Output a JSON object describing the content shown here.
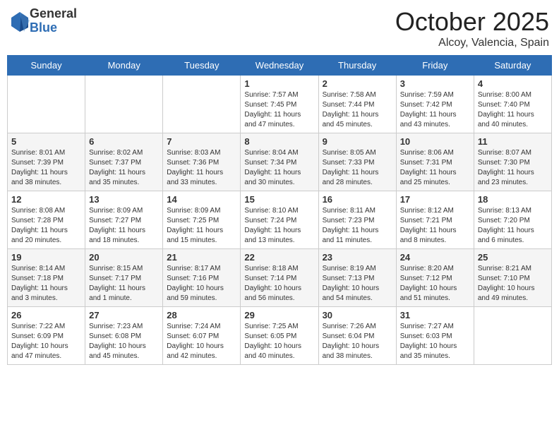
{
  "header": {
    "logo_general": "General",
    "logo_blue": "Blue",
    "month": "October 2025",
    "location": "Alcoy, Valencia, Spain"
  },
  "weekdays": [
    "Sunday",
    "Monday",
    "Tuesday",
    "Wednesday",
    "Thursday",
    "Friday",
    "Saturday"
  ],
  "weeks": [
    [
      {
        "day": "",
        "info": ""
      },
      {
        "day": "",
        "info": ""
      },
      {
        "day": "",
        "info": ""
      },
      {
        "day": "1",
        "info": "Sunrise: 7:57 AM\nSunset: 7:45 PM\nDaylight: 11 hours and 47 minutes."
      },
      {
        "day": "2",
        "info": "Sunrise: 7:58 AM\nSunset: 7:44 PM\nDaylight: 11 hours and 45 minutes."
      },
      {
        "day": "3",
        "info": "Sunrise: 7:59 AM\nSunset: 7:42 PM\nDaylight: 11 hours and 43 minutes."
      },
      {
        "day": "4",
        "info": "Sunrise: 8:00 AM\nSunset: 7:40 PM\nDaylight: 11 hours and 40 minutes."
      }
    ],
    [
      {
        "day": "5",
        "info": "Sunrise: 8:01 AM\nSunset: 7:39 PM\nDaylight: 11 hours and 38 minutes."
      },
      {
        "day": "6",
        "info": "Sunrise: 8:02 AM\nSunset: 7:37 PM\nDaylight: 11 hours and 35 minutes."
      },
      {
        "day": "7",
        "info": "Sunrise: 8:03 AM\nSunset: 7:36 PM\nDaylight: 11 hours and 33 minutes."
      },
      {
        "day": "8",
        "info": "Sunrise: 8:04 AM\nSunset: 7:34 PM\nDaylight: 11 hours and 30 minutes."
      },
      {
        "day": "9",
        "info": "Sunrise: 8:05 AM\nSunset: 7:33 PM\nDaylight: 11 hours and 28 minutes."
      },
      {
        "day": "10",
        "info": "Sunrise: 8:06 AM\nSunset: 7:31 PM\nDaylight: 11 hours and 25 minutes."
      },
      {
        "day": "11",
        "info": "Sunrise: 8:07 AM\nSunset: 7:30 PM\nDaylight: 11 hours and 23 minutes."
      }
    ],
    [
      {
        "day": "12",
        "info": "Sunrise: 8:08 AM\nSunset: 7:28 PM\nDaylight: 11 hours and 20 minutes."
      },
      {
        "day": "13",
        "info": "Sunrise: 8:09 AM\nSunset: 7:27 PM\nDaylight: 11 hours and 18 minutes."
      },
      {
        "day": "14",
        "info": "Sunrise: 8:09 AM\nSunset: 7:25 PM\nDaylight: 11 hours and 15 minutes."
      },
      {
        "day": "15",
        "info": "Sunrise: 8:10 AM\nSunset: 7:24 PM\nDaylight: 11 hours and 13 minutes."
      },
      {
        "day": "16",
        "info": "Sunrise: 8:11 AM\nSunset: 7:23 PM\nDaylight: 11 hours and 11 minutes."
      },
      {
        "day": "17",
        "info": "Sunrise: 8:12 AM\nSunset: 7:21 PM\nDaylight: 11 hours and 8 minutes."
      },
      {
        "day": "18",
        "info": "Sunrise: 8:13 AM\nSunset: 7:20 PM\nDaylight: 11 hours and 6 minutes."
      }
    ],
    [
      {
        "day": "19",
        "info": "Sunrise: 8:14 AM\nSunset: 7:18 PM\nDaylight: 11 hours and 3 minutes."
      },
      {
        "day": "20",
        "info": "Sunrise: 8:15 AM\nSunset: 7:17 PM\nDaylight: 11 hours and 1 minute."
      },
      {
        "day": "21",
        "info": "Sunrise: 8:17 AM\nSunset: 7:16 PM\nDaylight: 10 hours and 59 minutes."
      },
      {
        "day": "22",
        "info": "Sunrise: 8:18 AM\nSunset: 7:14 PM\nDaylight: 10 hours and 56 minutes."
      },
      {
        "day": "23",
        "info": "Sunrise: 8:19 AM\nSunset: 7:13 PM\nDaylight: 10 hours and 54 minutes."
      },
      {
        "day": "24",
        "info": "Sunrise: 8:20 AM\nSunset: 7:12 PM\nDaylight: 10 hours and 51 minutes."
      },
      {
        "day": "25",
        "info": "Sunrise: 8:21 AM\nSunset: 7:10 PM\nDaylight: 10 hours and 49 minutes."
      }
    ],
    [
      {
        "day": "26",
        "info": "Sunrise: 7:22 AM\nSunset: 6:09 PM\nDaylight: 10 hours and 47 minutes."
      },
      {
        "day": "27",
        "info": "Sunrise: 7:23 AM\nSunset: 6:08 PM\nDaylight: 10 hours and 45 minutes."
      },
      {
        "day": "28",
        "info": "Sunrise: 7:24 AM\nSunset: 6:07 PM\nDaylight: 10 hours and 42 minutes."
      },
      {
        "day": "29",
        "info": "Sunrise: 7:25 AM\nSunset: 6:05 PM\nDaylight: 10 hours and 40 minutes."
      },
      {
        "day": "30",
        "info": "Sunrise: 7:26 AM\nSunset: 6:04 PM\nDaylight: 10 hours and 38 minutes."
      },
      {
        "day": "31",
        "info": "Sunrise: 7:27 AM\nSunset: 6:03 PM\nDaylight: 10 hours and 35 minutes."
      },
      {
        "day": "",
        "info": ""
      }
    ]
  ]
}
